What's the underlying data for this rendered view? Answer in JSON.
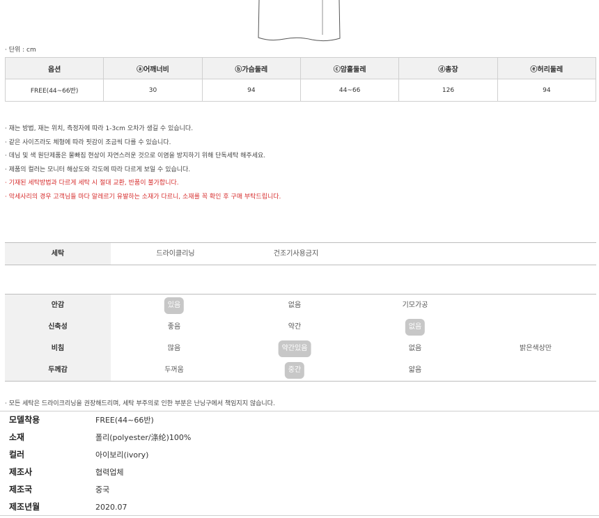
{
  "unit_note": "· 단위 : cm",
  "size_table": {
    "headers": [
      "옵션",
      "ⓐ어깨너비",
      "ⓑ가슴둘레",
      "ⓒ암홀둘레",
      "ⓓ총장",
      "ⓔ허리둘레"
    ],
    "rows": [
      [
        "FREE(44~66반)",
        "30",
        "94",
        "44~66",
        "126",
        "94"
      ]
    ]
  },
  "notes": [
    {
      "text": "· 재는 방법, 재는 위치, 측정자에 따라 1-3cm 오차가 생길 수 있습니다.",
      "warning": false
    },
    {
      "text": "· 같은 사이즈라도 체형에 따라 핏감이 조금씩 다를 수 있습니다.",
      "warning": false
    },
    {
      "text": "· 데님 및 색 원단제품은 물빠짐 현상이 자연스러운 것으로 이염을 방지하기 위해 단독세탁 해주세요.",
      "warning": false
    },
    {
      "text": "· 제품의 컬러는 모니터 해상도와 각도에 따라 다르게 보일 수 있습니다.",
      "warning": false
    },
    {
      "text": "· 기재된 세탁방법과 다르게 세탁 시 절대 교환, 반품이 불가합니다.",
      "warning": true
    },
    {
      "text": "· 악세사리의 경우 고객님들 마다 알레르기 유발하는 소재가 다르니, 소재를 꼭 확인 후 구매 부탁드립니다.",
      "warning": true
    }
  ],
  "washing": {
    "label": "세탁",
    "options": [
      "드라이클리닝",
      "건조기사용금지"
    ]
  },
  "properties": [
    {
      "label": "안감",
      "options": [
        "있음",
        "없음",
        "기모가공"
      ],
      "selected": 0
    },
    {
      "label": "신축성",
      "options": [
        "좋음",
        "약간",
        "없음"
      ],
      "selected": 2
    },
    {
      "label": "비침",
      "options": [
        "많음",
        "약간있음",
        "없음",
        "밝은색상만"
      ],
      "selected": 1
    },
    {
      "label": "두께감",
      "options": [
        "두꺼움",
        "중간",
        "얇음"
      ],
      "selected": 1
    }
  ],
  "wash_note": "· 모든 세탁은 드라이크리닝을 권장해드리며, 세탁 부주의로 인한 부분은 난닝구에서 책임지지 않습니다.",
  "product_info": [
    {
      "key": "모델착용",
      "value": "FREE(44~66반)"
    },
    {
      "key": "소재",
      "value": "폴리(polyester/涤纶)100%"
    },
    {
      "key": "컬러",
      "value": "아이보리(ivory)"
    },
    {
      "key": "제조사",
      "value": "협력업체"
    },
    {
      "key": "제조국",
      "value": "중국"
    },
    {
      "key": "제조년월",
      "value": "2020.07"
    }
  ],
  "colors": {
    "header_bg": "#f1f1f1",
    "border": "#cfcfcf",
    "selected_pill": "#c7c7c7",
    "warning_text": "#d62c2c"
  }
}
